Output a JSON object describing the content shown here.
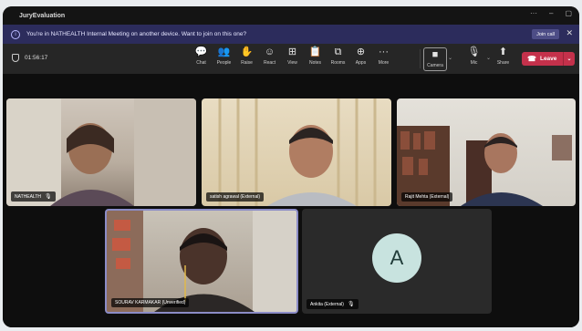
{
  "window": {
    "title": "JuryEvaluation",
    "controls": [
      "···",
      "–",
      "▢"
    ]
  },
  "banner": {
    "info_icon": "i",
    "message": "You're in NATHEALTH Internal Meeting on another device. Want to join on this one?",
    "join_label": "Join call",
    "close_icon": "✕"
  },
  "toolbar": {
    "timer": "01:56:17",
    "tools": [
      {
        "icon": "chat-icon",
        "glyph": "💬",
        "label": "Chat"
      },
      {
        "icon": "people-icon",
        "glyph": "👥",
        "label": "People"
      },
      {
        "icon": "raise-hand-icon",
        "glyph": "✋",
        "label": "Raise"
      },
      {
        "icon": "react-icon",
        "glyph": "☺",
        "label": "React"
      },
      {
        "icon": "view-icon",
        "glyph": "⊞",
        "label": "View"
      },
      {
        "icon": "notes-icon",
        "glyph": "📋",
        "label": "Notes"
      },
      {
        "icon": "rooms-icon",
        "glyph": "⧉",
        "label": "Rooms"
      },
      {
        "icon": "apps-icon",
        "glyph": "⊕",
        "label": "Apps"
      },
      {
        "icon": "more-icon",
        "glyph": "···",
        "label": "More"
      }
    ],
    "camera": {
      "glyph": "■",
      "label": "Camera"
    },
    "mic": {
      "glyph": "🎙",
      "label": "Mic"
    },
    "share": {
      "glyph": "⬆",
      "label": "Share"
    },
    "leave": {
      "glyph": "☎",
      "label": "Leave",
      "caret": "⌄"
    }
  },
  "participants": [
    {
      "name": "NATHEALTH",
      "mic": "🎙"
    },
    {
      "name": "satish agrawal (External)"
    },
    {
      "name": "Rajit Mehta (External)"
    },
    {
      "name": "SOURAV KARMAKAR (Unverified)"
    },
    {
      "name": "Ankita (External)",
      "mic": "🎙",
      "initial": "A"
    }
  ],
  "colors": {
    "leave": "#c4314b",
    "banner": "#2c2c5c",
    "active_speaker": "#8b8cc7"
  }
}
